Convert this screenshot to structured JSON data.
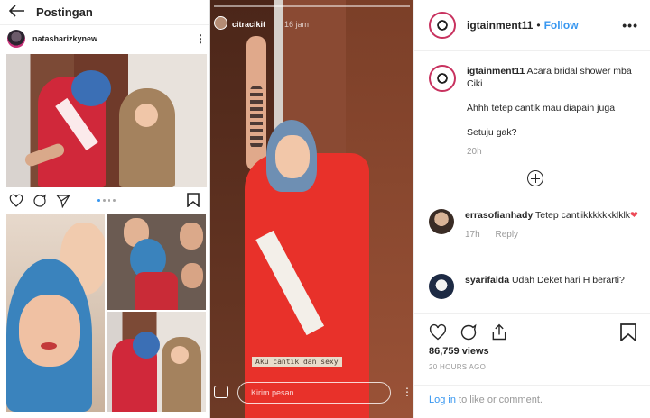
{
  "left_post": {
    "header_title": "Postingan",
    "back_icon": "arrow-left-icon",
    "username": "natasharizkynew",
    "more_glyph": "⋮"
  },
  "story": {
    "username": "citracikit",
    "time": "16 jam",
    "caption": "Aku cantik dan sexy",
    "reply_placeholder": "Kirim pesan",
    "more_glyph": "⋮"
  },
  "post": {
    "username": "igtainment11",
    "separator": "•",
    "follow_label": "Follow",
    "more_glyph": "•••",
    "caption_author": "igtainment11",
    "caption_lines": [
      "Acara bridal shower mba Ciki",
      "Ahhh tetep cantik mau diapain juga",
      "Setuju gak?"
    ],
    "caption_time": "20h",
    "comments": [
      {
        "username": "errasofianhady",
        "text": "Tetep cantiikkkkkkklklk",
        "emoji": "❤",
        "time": "17h",
        "reply_label": "Reply"
      },
      {
        "username": "syarifalda",
        "text": "Udah Deket hari H berarti?"
      }
    ],
    "likes": "86,759 views",
    "timestamp": "20 HOURS AGO",
    "login_link": "Log in",
    "login_rest": " to like or comment."
  },
  "colors": {
    "link": "#3897f0",
    "meta": "#999999",
    "border": "#efefef",
    "heart": "#ed4956"
  }
}
